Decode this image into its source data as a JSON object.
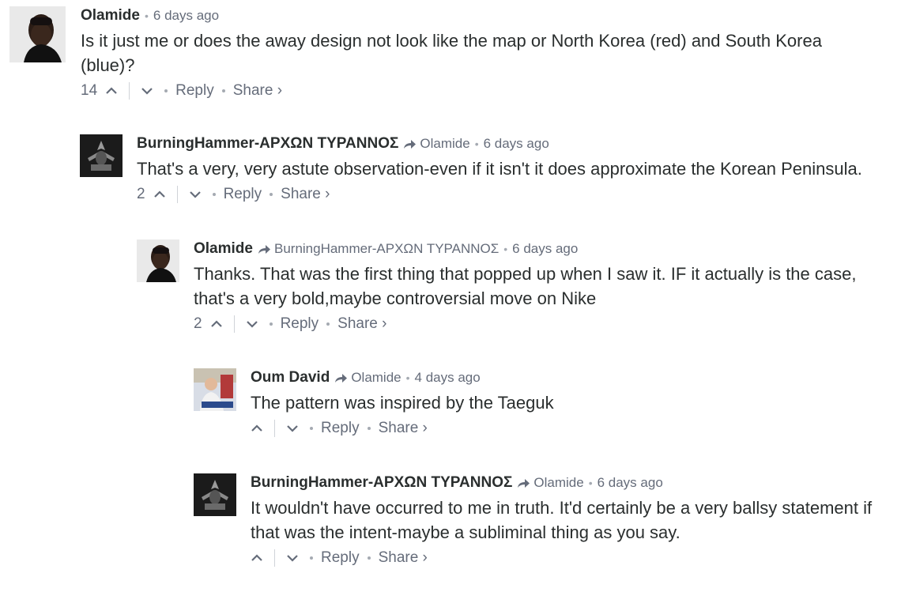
{
  "comments": [
    {
      "author": "Olamide",
      "parent": "",
      "time": "6 days ago",
      "text": "Is it just me or does the away design not look like the map or North Korea (red) and South Korea (blue)?",
      "votes": "14",
      "reply_label": "Reply",
      "share_label": "Share ›",
      "avatar_icon": "man-portrait-avatar"
    },
    {
      "author": "BurningHammer-ΑΡΧΩΝ ΤΥΡΑΝΝΟΣ",
      "parent": "Olamide",
      "time": "6 days ago",
      "text": "That's a very, very astute observation-even if it isn't it does approximate the Korean Peninsula.",
      "votes": "2",
      "reply_label": "Reply",
      "share_label": "Share ›",
      "avatar_icon": "dark-hammers-avatar"
    },
    {
      "author": "Olamide",
      "parent": "BurningHammer-ΑΡΧΩΝ ΤΥΡΑΝΝΟΣ",
      "time": "6 days ago",
      "text": "Thanks. That was the first thing that popped up when I saw it. IF it actually is the case, that's a very bold,maybe controversial move on Nike",
      "votes": "2",
      "reply_label": "Reply",
      "share_label": "Share ›",
      "avatar_icon": "man-portrait-avatar"
    },
    {
      "author": "Oum David",
      "parent": "Olamide",
      "time": "4 days ago",
      "text": "The pattern was inspired by the Taeguk",
      "votes": "",
      "reply_label": "Reply",
      "share_label": "Share ›",
      "avatar_icon": "person-photo-avatar"
    },
    {
      "author": "BurningHammer-ΑΡΧΩΝ ΤΥΡΑΝΝΟΣ",
      "parent": "Olamide",
      "time": "6 days ago",
      "text": "It wouldn't have occurred to me in truth. It'd certainly be a very ballsy statement if that was the intent-maybe a subliminal thing as you say.",
      "votes": "",
      "reply_label": "Reply",
      "share_label": "Share ›",
      "avatar_icon": "dark-hammers-avatar"
    }
  ],
  "colors": {
    "text": "#2a2e2e",
    "meta": "#656c7a",
    "separator": "#d0d3d8"
  }
}
